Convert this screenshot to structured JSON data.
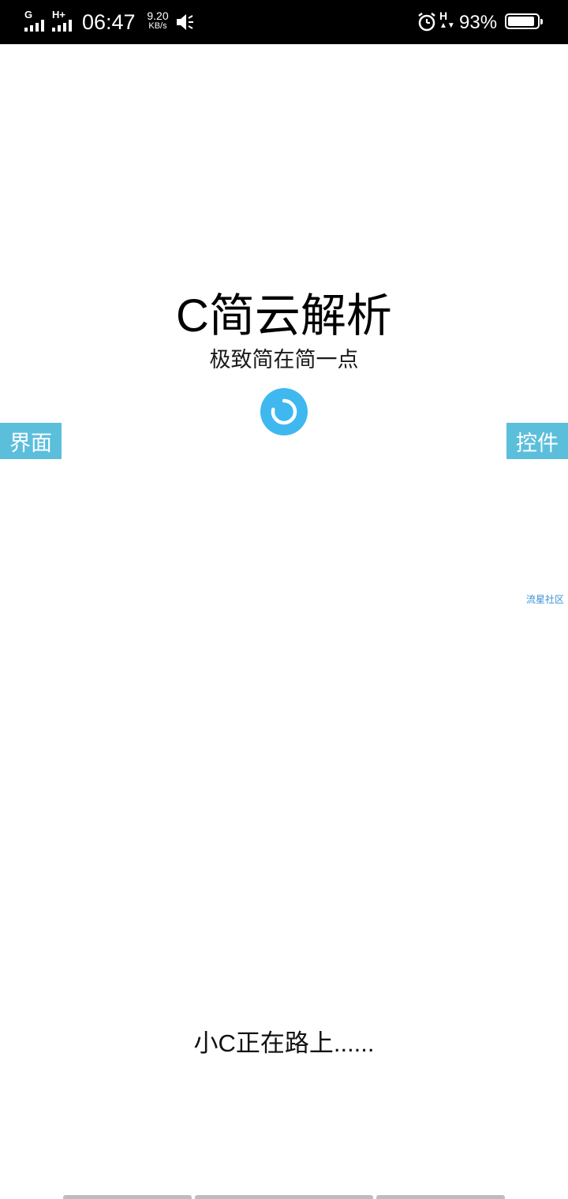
{
  "status_bar": {
    "network_1": "G",
    "network_2": "H+",
    "time": "06:47",
    "speed_value": "9.20",
    "speed_unit": "KB/s",
    "icons": [
      "signal-icon",
      "signal-icon",
      "mute-icon",
      "alarm-icon",
      "hd-icon",
      "battery-icon"
    ],
    "hd_label": "H",
    "battery_percent": "93%",
    "battery_level": 0.93
  },
  "splash": {
    "title": "C简云解析",
    "subtitle": "极致简在简一点",
    "spinner_icon": "loading-spinner-icon",
    "accent_color": "#3fb8ef",
    "left_tab": "界面",
    "right_tab": "控件",
    "tab_color": "#5bbfdc",
    "community_link": "流星社区",
    "loading_text": "小C正在路上......"
  },
  "nav": {
    "bars": [
      "nav-bar",
      "nav-bar",
      "nav-bar"
    ]
  }
}
